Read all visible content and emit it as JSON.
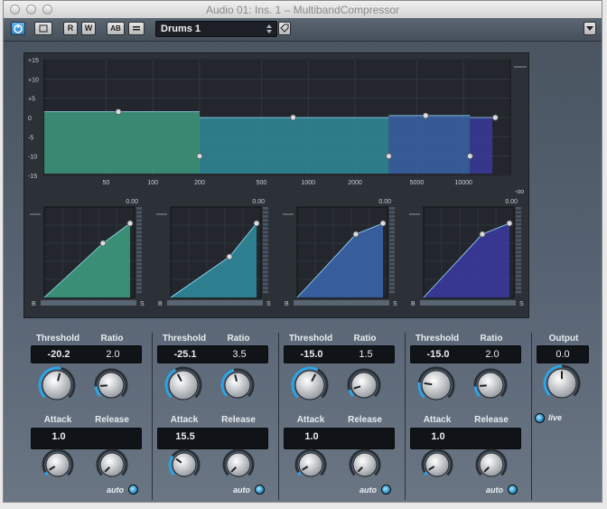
{
  "window": {
    "title": "Audio 01: Ins. 1 – MultibandCompressor"
  },
  "toolbar": {
    "power_label": "",
    "bypass_label": "",
    "read_label": "R",
    "write_label": "W",
    "ab_label": "AB",
    "menu_label": "",
    "preset_name": "Drums 1"
  },
  "freq_display": {
    "db_labels": [
      "+15",
      "+10",
      "+5",
      "0",
      "-5",
      "-10",
      "-15"
    ],
    "freq_labels": [
      "50",
      "100",
      "200",
      "500",
      "1000",
      "2000",
      "5000",
      "10000"
    ],
    "inf_label": "-oo",
    "band_gains_db": [
      1.5,
      0,
      0.5,
      0
    ],
    "colors": {
      "band1": "#3d9a7e",
      "band2": "#2f8a9a",
      "band3": "#3a64a8",
      "band4": "#3a3a9c"
    }
  },
  "curves": [
    {
      "peak": "0.00",
      "min_label": "B",
      "max_label": "S"
    },
    {
      "peak": "0.00",
      "min_label": "B",
      "max_label": "S"
    },
    {
      "peak": "0.00",
      "min_label": "B",
      "max_label": "S"
    },
    {
      "peak": "0.00",
      "min_label": "B",
      "max_label": "S"
    }
  ],
  "bands": [
    {
      "threshold_label": "Threshold",
      "threshold": "-20.2",
      "ratio_label": "Ratio",
      "ratio": "2.0",
      "attack_label": "Attack",
      "attack": "1.0",
      "release_label": "Release",
      "auto_label": "auto"
    },
    {
      "threshold_label": "Threshold",
      "threshold": "-25.1",
      "ratio_label": "Ratio",
      "ratio": "3.5",
      "attack_label": "Attack",
      "attack": "15.5",
      "release_label": "Release",
      "auto_label": "auto"
    },
    {
      "threshold_label": "Threshold",
      "threshold": "-15.0",
      "ratio_label": "Ratio",
      "ratio": "1.5",
      "attack_label": "Attack",
      "attack": "1.0",
      "release_label": "Release",
      "auto_label": "auto"
    },
    {
      "threshold_label": "Threshold",
      "threshold": "-15.0",
      "ratio_label": "Ratio",
      "ratio": "2.0",
      "attack_label": "Attack",
      "attack": "1.0",
      "release_label": "Release",
      "auto_label": "auto"
    }
  ],
  "output": {
    "label": "Output",
    "value": "0.0",
    "live_label": "live"
  }
}
